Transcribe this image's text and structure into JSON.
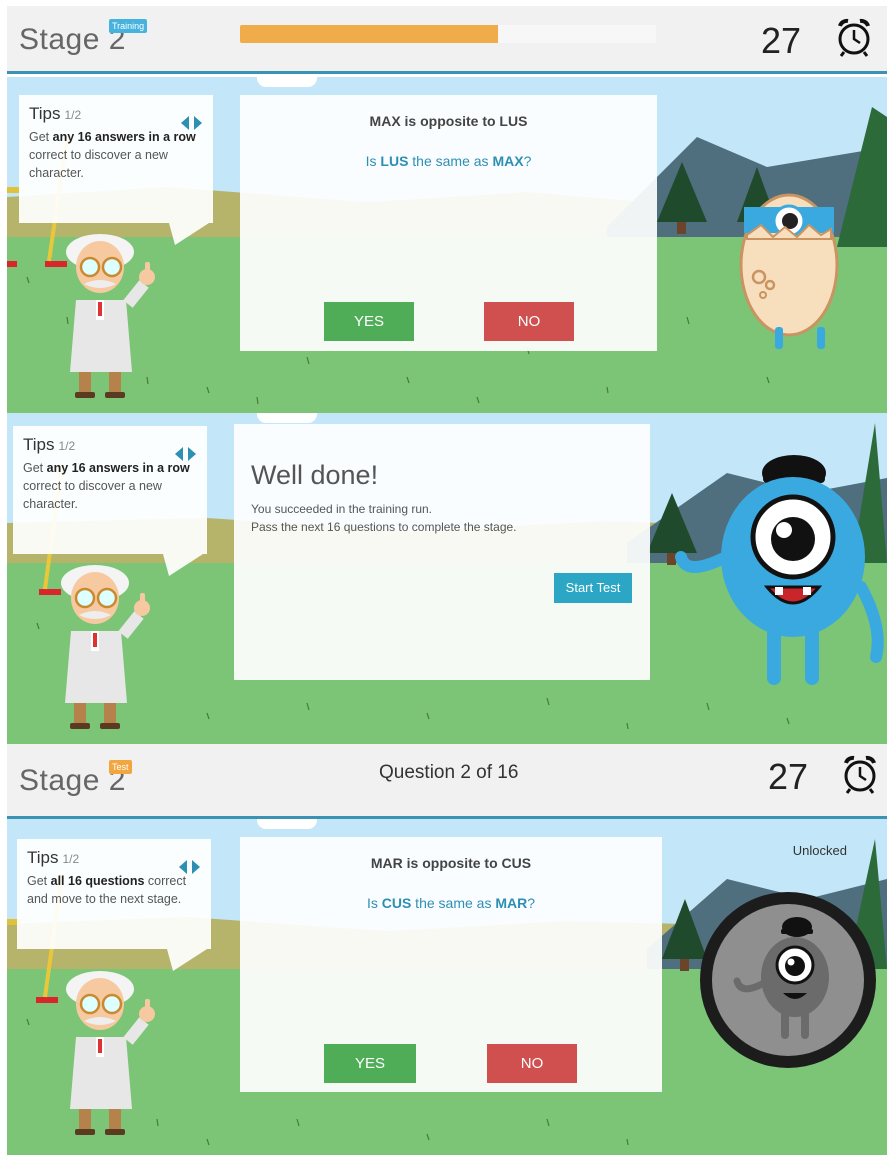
{
  "screens": [
    {
      "stage_title": "Stage 2",
      "mode_badge": "Training",
      "progress": 0.62,
      "timer": "27",
      "tips": {
        "title": "Tips",
        "page": "1/2",
        "text_pre": "Get ",
        "text_bold": "any 16 answers in a row",
        "text_post": " correct to discover a new character."
      },
      "card": {
        "premise": "MAX is opposite to LUS",
        "q_pre": "Is ",
        "q_a": "LUS",
        "q_mid": " the same as ",
        "q_b": "MAX",
        "q_post": "?",
        "yes_label": "YES",
        "no_label": "NO"
      },
      "character": "egg-monster"
    },
    {
      "tips": {
        "title": "Tips",
        "page": "1/2",
        "text_pre": "Get ",
        "text_bold": "any 16 answers in a row",
        "text_post": " correct to discover a new character."
      },
      "result": {
        "title": "Well done!",
        "line1": "You succeeded in the training run.",
        "line2": "Pass the next 16 questions to complete the stage.",
        "start_label": "Start Test"
      },
      "character": "blue-cyclops-monster"
    },
    {
      "stage_title": "Stage 2",
      "mode_badge": "Test",
      "question_counter": "Question 2 of 16",
      "timer": "27",
      "tips": {
        "title": "Tips",
        "page": "1/2",
        "text_pre": "Get ",
        "text_bold": "all 16 questions",
        "text_post": " correct and move to the next stage."
      },
      "card": {
        "premise": "MAR is opposite to CUS",
        "q_pre": "Is ",
        "q_a": "CUS",
        "q_mid": " the same as ",
        "q_b": "MAR",
        "q_post": "?",
        "yes_label": "YES",
        "no_label": "NO"
      },
      "unlocked_label": "Unlocked",
      "character": "locked-monster"
    }
  ],
  "colors": {
    "accent": "#2d8fb2",
    "yes": "#4fad58",
    "no": "#cf504f",
    "progress": "#f0ab4b",
    "grass": "#7cc576",
    "sky": "#bfe6f8"
  }
}
